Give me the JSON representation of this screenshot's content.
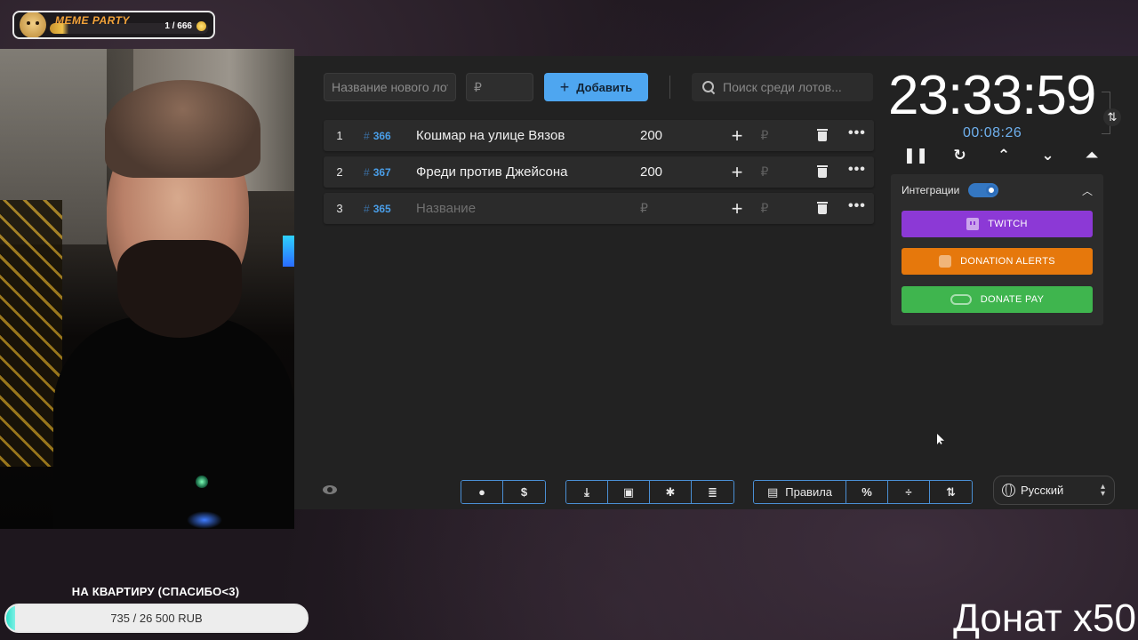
{
  "meme_widget": {
    "title": "MEME PARTY",
    "count": "1 / 666"
  },
  "goal": {
    "title": "НА КВАРТИРУ (СПАСИБО<3)",
    "progress_text": "735 / 26 500 RUB",
    "progress_fraction": 0.03
  },
  "overlay_text": "Донат x50",
  "toolbar": {
    "lot_name_placeholder": "Название нового лота",
    "price_placeholder": "₽",
    "add_label": "Добавить",
    "search_placeholder": "Поиск среди лотов..."
  },
  "lots": [
    {
      "index": "1",
      "id": "366",
      "name": "Кошмар на улице Вязов",
      "amount": "200",
      "rub": "₽"
    },
    {
      "index": "2",
      "id": "367",
      "name": "Фреди против Джейсона",
      "amount": "200",
      "rub": "₽"
    },
    {
      "index": "3",
      "id": "365",
      "name": "Название",
      "amount": "₽",
      "rub": "₽"
    }
  ],
  "timer": {
    "main": "23:33:59",
    "elapsed": "00:08:26"
  },
  "integrations": {
    "label": "Интеграции",
    "enabled": true,
    "twitch": "TWITCH",
    "donation_alerts": "DONATION ALERTS",
    "donate_pay": "DONATE PAY"
  },
  "footer": {
    "rules_label": "Правила",
    "percent_label": "%",
    "language": "Русский"
  },
  "colors": {
    "accent": "#4ea6f0",
    "twitch": "#8c39d6",
    "donation_alerts": "#e6780c",
    "donate_pay": "#3fb54e",
    "timer_sub": "#6fb0ee"
  }
}
